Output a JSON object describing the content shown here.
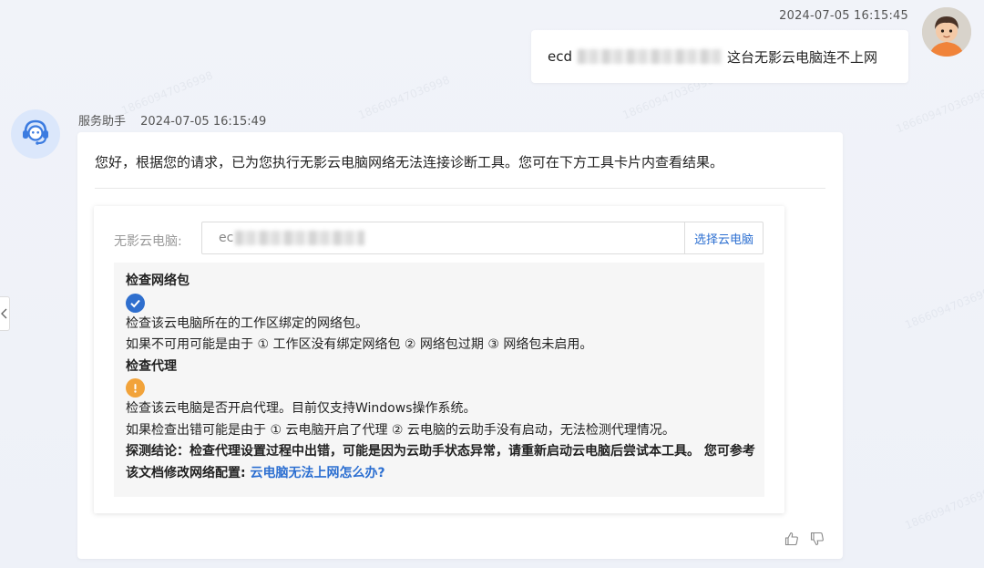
{
  "user_message": {
    "timestamp": "2024-07-05 16:15:45",
    "prefix": "ecd",
    "text": "这台无影云电脑连不上网"
  },
  "assistant": {
    "name": "服务助手",
    "timestamp": "2024-07-05 16:15:49",
    "intro": "您好，根据您的请求，已为您执行无影云电脑网络无法连接诊断工具。您可在下方工具卡片内查看结果。",
    "tool": {
      "pc_label": "无影云电脑:",
      "pc_value_prefix": "ec",
      "select_button": "选择云电脑",
      "checks": [
        {
          "title": "检查网络包",
          "status": "ok",
          "desc": "检查该云电脑所在的工作区绑定的网络包。",
          "note": "如果不可用可能是由于 ① 工作区没有绑定网络包 ② 网络包过期 ③ 网络包未启用。"
        },
        {
          "title": "检查代理",
          "status": "warning",
          "desc": "检查该云电脑是否开启代理。目前仅支持Windows操作系统。",
          "note": "如果检查出错可能是由于 ① 云电脑开启了代理 ② 云电脑的云助手没有启动，无法检测代理情况。"
        }
      ],
      "conclusion": "探测结论：检查代理设置过程中出错，可能是因为云助手状态异常，请重新启动云电脑后尝试本工具。 您可参考该文档修改网络配置: ",
      "conclusion_link": "云电脑无法上网怎么办?"
    }
  },
  "watermark_text": "18660947036998",
  "colors": {
    "accent": "#2c6fd1",
    "ok": "#2f6fce",
    "warning": "#f2a33a"
  },
  "icons": [
    "user-avatar",
    "bot-headset-avatar",
    "check-icon",
    "exclamation-icon",
    "thumbs-up-icon",
    "thumbs-down-icon",
    "chevron-left-icon"
  ]
}
